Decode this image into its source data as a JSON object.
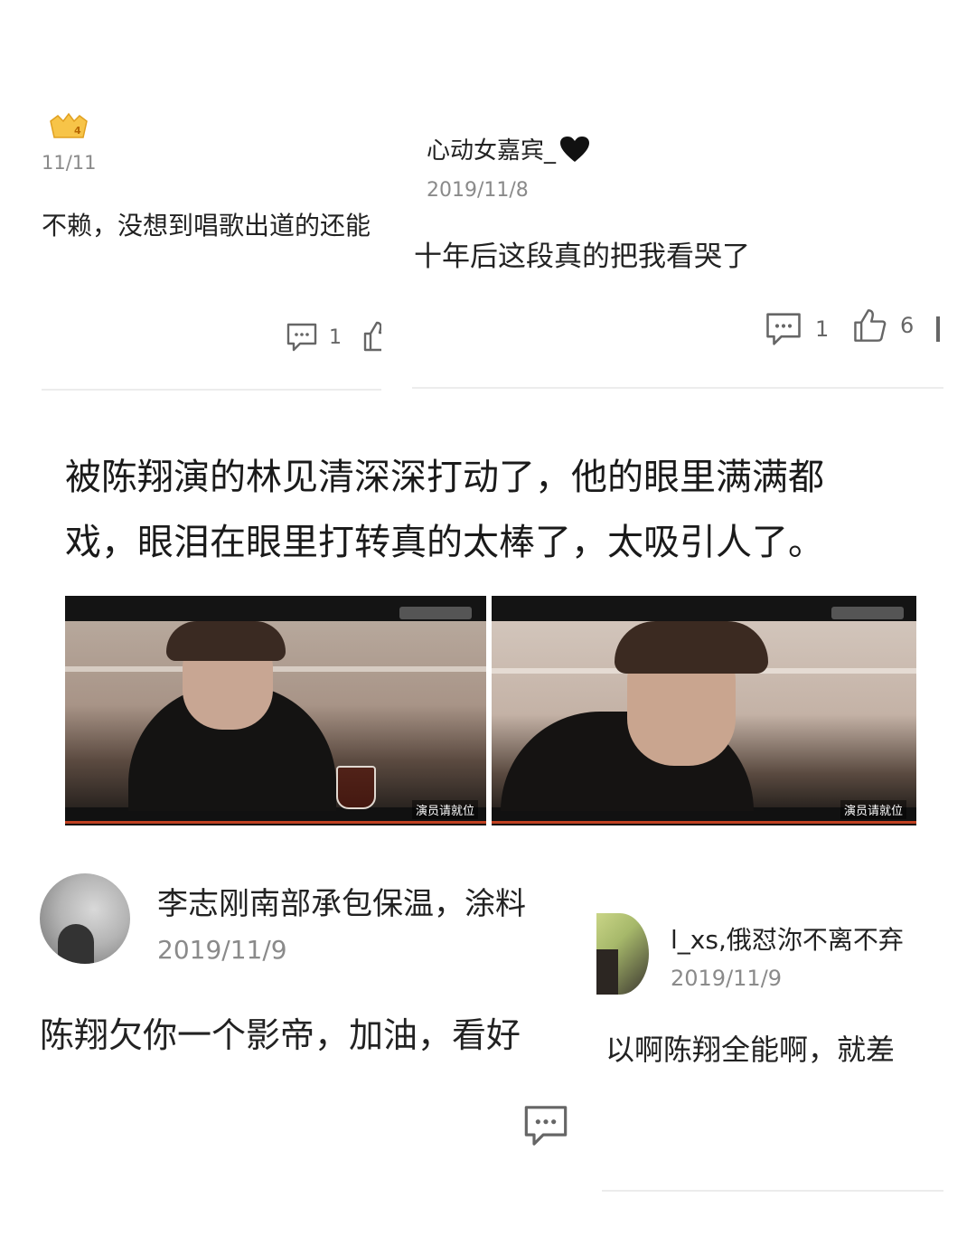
{
  "left_top_comment": {
    "badge_level": "4",
    "date": "11/11",
    "text": "不赖，没想到唱歌出道的还能",
    "reply_count": "1"
  },
  "right_top_comment": {
    "username": "心动女嘉宾_",
    "date": "2019/11/8",
    "text": "十年后这段真的把我看哭了",
    "reply_count": "1",
    "like_count": "6"
  },
  "caption": {
    "line1": "被陈翔演的林见清深深打动了，他的眼里满满都",
    "line2": "戏，眼泪在眼里打转真的太棒了，太吸引人了。"
  },
  "screenshots": {
    "left_overlay": "演员请就位",
    "right_overlay": "演员请就位"
  },
  "left_bottom_comment": {
    "username": "李志刚南部承包保温，涂料",
    "date": "2019/11/9",
    "text": "陈翔欠你一个影帝，加油，看好"
  },
  "right_bottom_comment": {
    "username": "l_xs,俄怼沵不离不弃",
    "date": "2019/11/9",
    "text": "以啊陈翔全能啊，就差"
  },
  "icons": [
    "comment-icon",
    "thumbs-up-icon",
    "crown-badge-icon",
    "heart-icon"
  ]
}
